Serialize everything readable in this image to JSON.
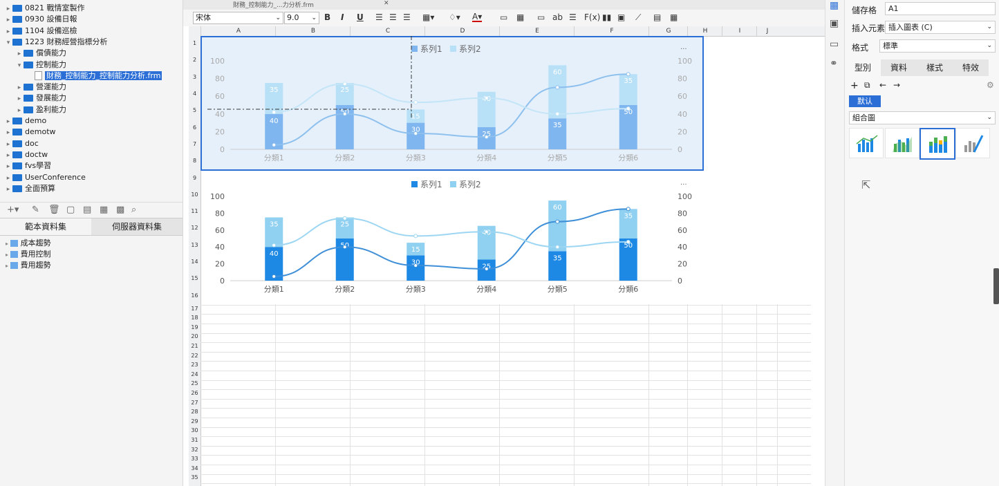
{
  "left_tree": {
    "items": [
      {
        "label": "0821 戰情室製作",
        "level": 0,
        "expanded": false
      },
      {
        "label": "0930 設備日報",
        "level": 0,
        "expanded": false
      },
      {
        "label": "1104 設備巡檢",
        "level": 0,
        "expanded": false
      },
      {
        "label": "1223 財務經營指標分析",
        "level": 0,
        "expanded": true
      },
      {
        "label": "償債能力",
        "level": 1,
        "expanded": false
      },
      {
        "label": "控制能力",
        "level": 1,
        "expanded": true
      },
      {
        "label": "財務_控制能力_控制能力分析.frm",
        "level": 2,
        "file": true,
        "selected": true
      },
      {
        "label": "營運能力",
        "level": 1,
        "expanded": false
      },
      {
        "label": "發展能力",
        "level": 1,
        "expanded": false
      },
      {
        "label": "盈利能力",
        "level": 1,
        "expanded": false
      },
      {
        "label": "demo",
        "level": 0,
        "expanded": false
      },
      {
        "label": "demotw",
        "level": 0,
        "expanded": false
      },
      {
        "label": "doc",
        "level": 0,
        "expanded": false
      },
      {
        "label": "doctw",
        "level": 0,
        "expanded": false
      },
      {
        "label": "fvs學習",
        "level": 0,
        "expanded": false
      },
      {
        "label": "UserConference",
        "level": 0,
        "expanded": false
      },
      {
        "label": "全面預算",
        "level": 0,
        "expanded": false
      }
    ]
  },
  "dataset_tabs": [
    "範本資料集",
    "伺服器資料集"
  ],
  "datasets": [
    "成本趨勢",
    "費用控制",
    "費用趨勢"
  ],
  "editor_tab": "財務_控制能力_...力分析.frm",
  "toolbar": {
    "font": "宋体",
    "size": "9.0",
    "bold": "B",
    "italic": "I",
    "underline": "U",
    "ab": "ab",
    "fx": "F(x)"
  },
  "columns": [
    "A",
    "B",
    "C",
    "D",
    "E",
    "F",
    "G",
    "H",
    "I",
    "J"
  ],
  "rows": [
    "1",
    "2",
    "3",
    "4",
    "5",
    "6",
    "7",
    "8",
    "9",
    "10",
    "11",
    "12",
    "13",
    "14",
    "15",
    "16",
    "17",
    "18",
    "19",
    "20",
    "21",
    "22",
    "23",
    "24",
    "25",
    "26",
    "27",
    "28",
    "29",
    "30",
    "31",
    "32",
    "33",
    "34",
    "35"
  ],
  "chart_data": {
    "type": "bar",
    "categories": [
      "分類1",
      "分類2",
      "分類3",
      "分類4",
      "分類5",
      "分類6"
    ],
    "series": [
      {
        "name": "系列1",
        "values": [
          40,
          50,
          30,
          25,
          35,
          50
        ],
        "type": "bar",
        "stack": true
      },
      {
        "name": "系列2",
        "values": [
          35,
          25,
          15,
          40,
          60,
          35
        ],
        "type": "bar",
        "stack": true
      },
      {
        "name": "系列1",
        "values": [
          5,
          40,
          18,
          14,
          70,
          85
        ],
        "type": "line"
      },
      {
        "name": "系列2",
        "values": [
          42,
          74,
          53,
          58,
          40,
          46
        ],
        "type": "line"
      }
    ],
    "ylim": [
      0,
      100
    ],
    "yticks": [
      "0",
      "20",
      "40",
      "60",
      "80",
      "100"
    ],
    "legend": "top-center",
    "more_label": "...",
    "colors": {
      "series1": "#1e88e5",
      "series2": "#90d0f0",
      "line1": "#3e8fd8",
      "line2": "#9dd6f2"
    }
  },
  "right_panel": {
    "cell_label": "儲存格",
    "cell_value": "A1",
    "insert_label": "插入元素",
    "insert_value": "插入圖表 (C)",
    "format_label": "格式",
    "format_value": "標準",
    "tabs": [
      "型別",
      "資料",
      "樣式",
      "特效"
    ],
    "default_btn": "默认",
    "chart_kind": "組合圖"
  }
}
